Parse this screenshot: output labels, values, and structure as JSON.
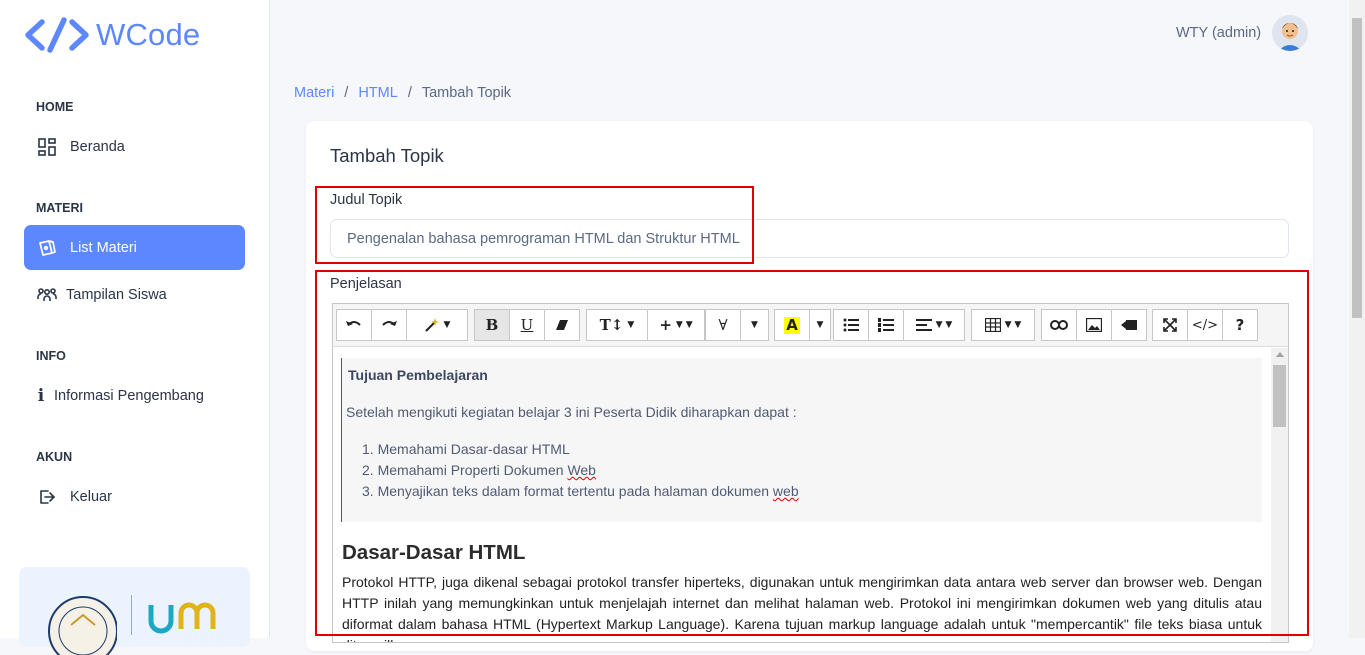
{
  "brand": {
    "name": "WCode"
  },
  "sidebar": {
    "sections": [
      {
        "caption": "HOME",
        "items": [
          {
            "label": "Beranda",
            "icon": "dashboard-icon"
          }
        ]
      },
      {
        "caption": "MATERI",
        "items": [
          {
            "label": "List Materi",
            "icon": "cards-icon",
            "active": true
          },
          {
            "label": "Tampilan Siswa",
            "icon": "users-icon"
          }
        ]
      },
      {
        "caption": "INFO",
        "items": [
          {
            "label": "Informasi Pengembang",
            "icon": "info-icon"
          }
        ]
      },
      {
        "caption": "AKUN",
        "items": [
          {
            "label": "Keluar",
            "icon": "logout-icon"
          }
        ]
      }
    ],
    "promo_logo_text": "um"
  },
  "topbar": {
    "user_label": "WTY (admin)"
  },
  "breadcrumb": {
    "items": [
      "Materi",
      "HTML",
      "Tambah Topik"
    ],
    "separator": "/"
  },
  "form": {
    "title": "Tambah Topik",
    "judul_label": "Judul Topik",
    "judul_value": "Pengenalan bahasa pemrograman HTML dan Struktur HTML",
    "penjelasan_label": "Penjelasan"
  },
  "editor": {
    "toolbar_buttons": [
      "undo",
      "redo",
      "magic",
      "bold",
      "underline",
      "eraser",
      "font-size",
      "plus",
      "font",
      "color",
      "ul",
      "ol",
      "align",
      "table",
      "link",
      "image",
      "video",
      "fullscreen",
      "code",
      "help"
    ],
    "box": {
      "title": "Tujuan Pembelajaran",
      "intro": "Setelah mengikuti kegiatan belajar 3 ini Peserta Didik diharapkan dapat :",
      "list": [
        {
          "num": "1.",
          "text": "Memahami Dasar-dasar HTML",
          "squiggle": ""
        },
        {
          "num": "2.",
          "text": "Memahami Properti Dokumen ",
          "squiggle": "Web"
        },
        {
          "num": "3.",
          "text": "Menyajikan teks dalam format tertentu pada halaman dokumen ",
          "squiggle": "web"
        }
      ]
    },
    "heading": "Dasar-Dasar HTML",
    "paragraph": "Protokol HTTP, juga dikenal sebagai protokol transfer hiperteks, digunakan untuk mengirimkan data antara web server dan browser web. Dengan HTTP inilah yang memungkinkan untuk menjelajah internet dan melihat halaman web. Protokol ini mengirimkan dokumen web yang ditulis atau diformat dalam bahasa HTML (Hypertext Markup Language). Karena tujuan markup language adalah untuk \"mempercantik\" file teks biasa untuk ditampilkan"
  },
  "colors": {
    "accent": "#5d87ff",
    "highlight_border": "#e00000",
    "text": "#2a3547"
  }
}
